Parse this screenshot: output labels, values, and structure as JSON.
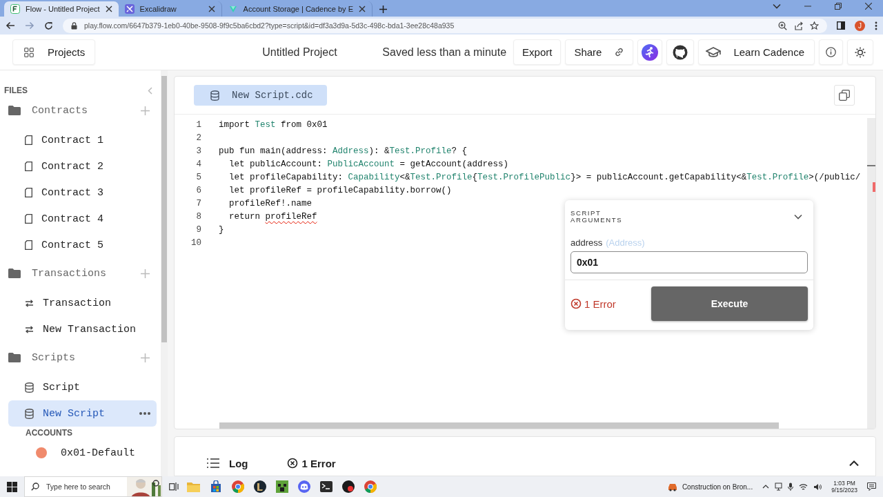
{
  "browser": {
    "tabs": [
      {
        "title": "Flow - Untitled Project",
        "selected": true,
        "kind": "flow"
      },
      {
        "title": "Excalidraw",
        "selected": false,
        "kind": "excalidraw"
      },
      {
        "title": "Account Storage | Cadence by E",
        "selected": false,
        "kind": "cadence"
      }
    ],
    "url": "play.flow.com/6647b379-1eb0-40be-9508-9f9c5ba6cbd2?type=script&id=df3a3d9a-5d3c-498c-bda1-3ee28c48a935",
    "profile_initial": "J"
  },
  "header": {
    "projects_button": "Projects",
    "project_title": "Untitled Project",
    "save_status": "Saved less than a minute",
    "export_button": "Export",
    "share_button": "Share",
    "learn_button": "Learn Cadence"
  },
  "sidebar": {
    "files_label": "FILES",
    "sections": [
      {
        "title": "Contracts",
        "kind": "contract",
        "items": [
          {
            "label": "Contract 1",
            "selected": false
          },
          {
            "label": "Contract 2",
            "selected": false
          },
          {
            "label": "Contract 3",
            "selected": false
          },
          {
            "label": "Contract 4",
            "selected": false
          },
          {
            "label": "Contract 5",
            "selected": false
          }
        ]
      },
      {
        "title": "Transactions",
        "kind": "transaction",
        "items": [
          {
            "label": "Transaction",
            "selected": false
          },
          {
            "label": "New Transaction",
            "selected": false
          }
        ]
      },
      {
        "title": "Scripts",
        "kind": "script",
        "items": [
          {
            "label": "Script",
            "selected": false
          },
          {
            "label": "New Script",
            "selected": true
          }
        ]
      }
    ],
    "accounts_label": "ACCOUNTS",
    "accounts": [
      {
        "label": "0x01-Default"
      }
    ]
  },
  "editor": {
    "file_tab": "New Script.cdc",
    "lines": [
      {
        "number": "1",
        "tokens": [
          {
            "text": "import ",
            "kind": "plain"
          },
          {
            "text": "Test",
            "kind": "type"
          },
          {
            "text": " from 0x01",
            "kind": "plain"
          }
        ]
      },
      {
        "number": "2"
      },
      {
        "number": "3",
        "tokens": [
          {
            "text": "pub fun main(address: ",
            "kind": "plain"
          },
          {
            "text": "Address",
            "kind": "type"
          },
          {
            "text": "): &",
            "kind": "plain"
          },
          {
            "text": "Test.Profile",
            "kind": "type"
          },
          {
            "text": "? {",
            "kind": "plain"
          }
        ]
      },
      {
        "number": "4",
        "tokens": [
          {
            "text": "  let publicAccount: ",
            "kind": "plain"
          },
          {
            "text": "PublicAccount",
            "kind": "type"
          },
          {
            "text": " = getAccount(address)",
            "kind": "plain"
          }
        ]
      },
      {
        "number": "5",
        "tokens": [
          {
            "text": "  let profileCapability: ",
            "kind": "plain"
          },
          {
            "text": "Capability",
            "kind": "type"
          },
          {
            "text": "<&",
            "kind": "plain"
          },
          {
            "text": "Test.Profile",
            "kind": "type"
          },
          {
            "text": "{",
            "kind": "plain"
          },
          {
            "text": "Test.ProfilePublic",
            "kind": "type"
          },
          {
            "text": "}> = publicAccount.getCapability<&",
            "kind": "plain"
          },
          {
            "text": "Test.Profile",
            "kind": "type"
          },
          {
            "text": ">(/public/",
            "kind": "plain"
          }
        ]
      },
      {
        "number": "6",
        "tokens": [
          {
            "text": "  let profileRef = profileCapability.borrow()",
            "kind": "plain"
          }
        ]
      },
      {
        "number": "7",
        "tokens": [
          {
            "text": "  profileRef!.name",
            "kind": "plain"
          }
        ]
      },
      {
        "number": "8",
        "tokens": [
          {
            "text": "  return ",
            "kind": "plain"
          },
          {
            "text": "profileRef",
            "kind": "error"
          }
        ]
      },
      {
        "number": "9",
        "tokens": [
          {
            "text": "}",
            "kind": "plain"
          }
        ]
      },
      {
        "number": "10"
      }
    ]
  },
  "script_arguments": {
    "title": "SCRIPT ARGUMENTS",
    "fields": [
      {
        "name": "address",
        "type_hint": "(Address)",
        "value": "0x01"
      }
    ],
    "error_count": "1 Error",
    "execute_button": "Execute"
  },
  "bottom_panel": {
    "tabs": [
      {
        "label": "Log",
        "kind": "log"
      },
      {
        "label": "1 Error",
        "kind": "error"
      }
    ]
  },
  "taskbar": {
    "search_placeholder": "Type here to search",
    "notification": "Construction on Bron...",
    "time": "1:03 PM",
    "date": "9/15/2023"
  }
}
